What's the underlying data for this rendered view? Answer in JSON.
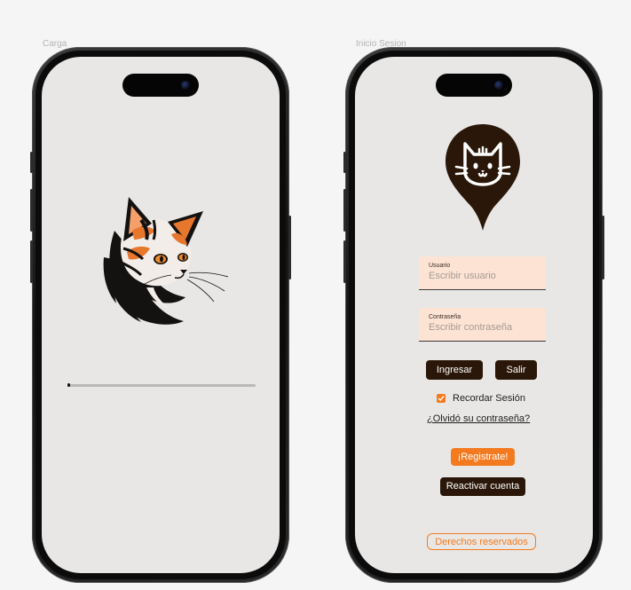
{
  "frames": {
    "loading": {
      "label": "Carga"
    },
    "login": {
      "label": "Inicio Sesion"
    }
  },
  "loading_screen": {
    "illustration": "tricolor-cat-head-illustration",
    "progress": 0.01
  },
  "login_screen": {
    "logo_icon": "cat-location-pin-icon",
    "username": {
      "label": "Usuario",
      "placeholder": "Escribir usuario"
    },
    "password": {
      "label": "Contraseña",
      "placeholder": "Escribir contraseña"
    },
    "login_button": "Ingresar",
    "exit_button": "Salir",
    "remember": {
      "label": "Recordar Sesión",
      "checked": true
    },
    "forgot_link": "¿Olvidó su contraseña?",
    "register_button": "¡Registrate!",
    "reactivate_button": "Reactivar cuenta",
    "rights_button": "Derechos reservados"
  },
  "colors": {
    "screen_background": "#e8e7e5",
    "dark_brown": "#2a1709",
    "orange_accent": "#f47a1f",
    "field_background": "#fde3d3"
  }
}
